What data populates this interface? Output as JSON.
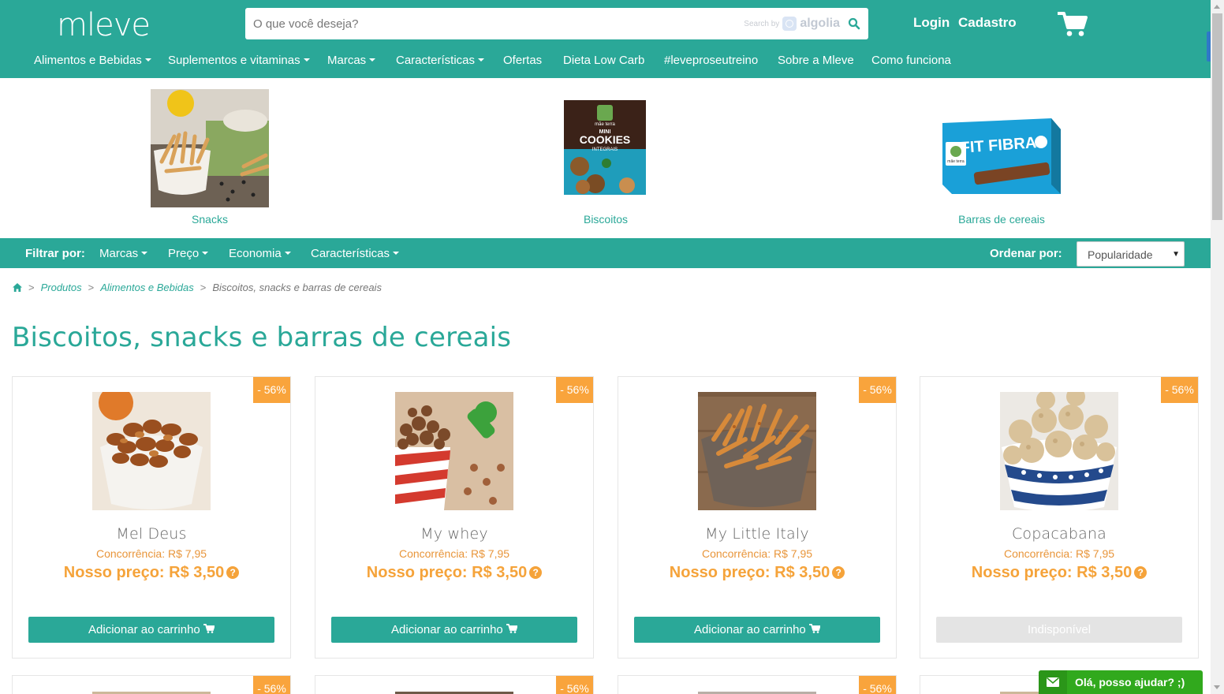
{
  "brand": {
    "logo_text": "mleve",
    "primary_color": "#2aa898",
    "accent_color": "#f9a43c"
  },
  "header": {
    "search_placeholder": "O que você deseja?",
    "search_by_label": "Search by",
    "search_provider": "algolia",
    "login_label": "Login",
    "signup_label": "Cadastro",
    "cart_icon": "shopping-cart-icon"
  },
  "nav": {
    "items": [
      {
        "label": "Alimentos e Bebidas",
        "dropdown": true
      },
      {
        "label": "Suplementos e vitaminas",
        "dropdown": true
      },
      {
        "label": "Marcas",
        "dropdown": true
      },
      {
        "label": "Características",
        "dropdown": true
      },
      {
        "label": "Ofertas",
        "dropdown": false
      },
      {
        "label": "Dieta Low Carb",
        "dropdown": false
      },
      {
        "label": "#leveproseutreino",
        "dropdown": false
      },
      {
        "label": "Sobre a Mleve",
        "dropdown": false
      },
      {
        "label": "Como funciona",
        "dropdown": false
      }
    ]
  },
  "categories": [
    {
      "label": "Snacks"
    },
    {
      "label": "Biscoitos"
    },
    {
      "label": "Barras de cereais"
    }
  ],
  "category_images": {
    "cookies_brand": "mãe terra",
    "cookies_line1": "MINI",
    "cookies_line2": "COOKIES",
    "cookies_line3": "INTEGRAIS",
    "bar_brand": "mãe terra",
    "bar_title": "FIT FIBRAS"
  },
  "filters": {
    "filter_label": "Filtrar por:",
    "items": [
      "Marcas",
      "Preço",
      "Economia",
      "Características"
    ],
    "sort_label": "Ordenar por:",
    "sort_selected": "Popularidade"
  },
  "breadcrumb": {
    "home_icon": "home-icon",
    "items": [
      "Produtos",
      "Alimentos e Bebidas"
    ],
    "current": "Biscoitos, snacks e barras de cereais"
  },
  "page": {
    "title": "Biscoitos, snacks e barras de cereais"
  },
  "products": [
    {
      "name": "Mel Deus",
      "discount": "- 56%",
      "competitor": "Concorrência: R$ 7,95",
      "price": "Nosso preço: R$ 3,50",
      "button": "Adicionar ao carrinho",
      "available": true
    },
    {
      "name": "My whey",
      "discount": "- 56%",
      "competitor": "Concorrência: R$ 7,95",
      "price": "Nosso preço: R$ 3,50",
      "button": "Adicionar ao carrinho",
      "available": true
    },
    {
      "name": "My Little Italy",
      "discount": "- 56%",
      "competitor": "Concorrência: R$ 7,95",
      "price": "Nosso preço: R$ 3,50",
      "button": "Adicionar ao carrinho",
      "available": true
    },
    {
      "name": "Copacabana",
      "discount": "- 56%",
      "competitor": "Concorrência: R$ 7,95",
      "price": "Nosso preço: R$ 3,50",
      "button": "Indisponível",
      "available": false
    }
  ],
  "products_row2": [
    {
      "discount": "- 56%"
    },
    {
      "discount": "- 56%"
    },
    {
      "discount": "- 56%"
    }
  ],
  "chat": {
    "label": "Olá, posso ajudar? ;)",
    "icon": "mail-icon"
  }
}
